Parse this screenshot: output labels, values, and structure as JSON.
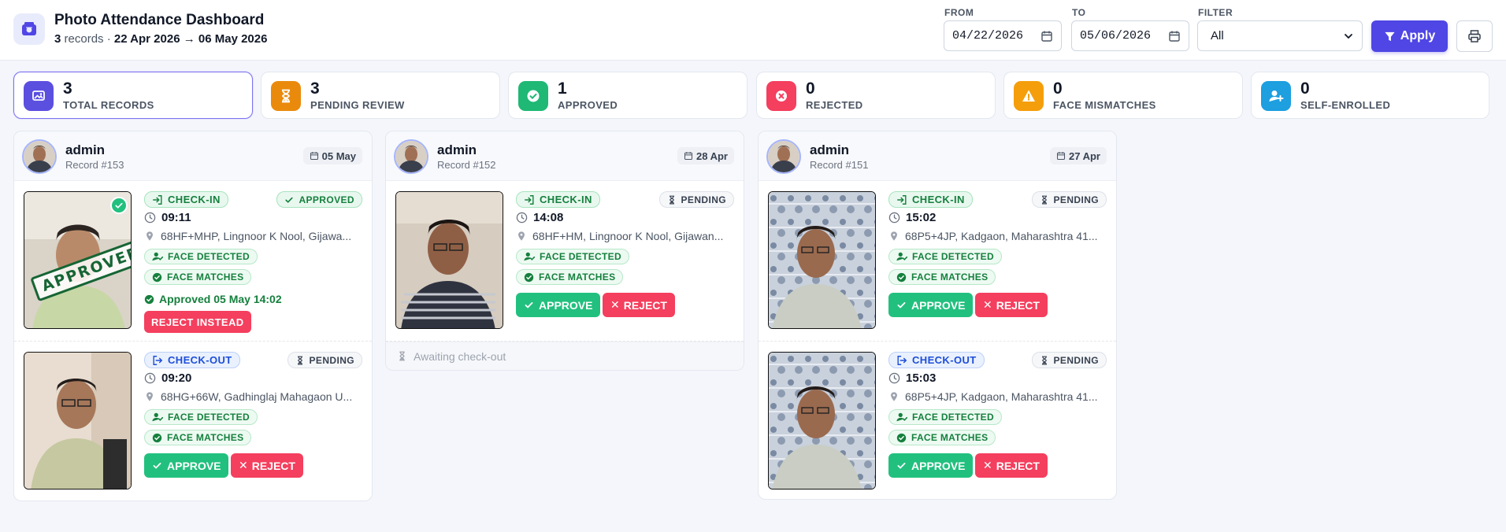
{
  "header": {
    "title": "Photo Attendance Dashboard",
    "record_count": "3",
    "records_word": "records",
    "separator": "·",
    "range_text": "22 Apr 2026 → 06 May 2026",
    "from_label": "FROM",
    "from_value": "04/22/2026",
    "to_label": "TO",
    "to_value": "05/06/2026",
    "filter_label": "FILTER",
    "filter_value": "All",
    "apply_label": "Apply"
  },
  "stats": [
    {
      "value": "3",
      "label": "TOTAL RECORDS",
      "icon": "photos-icon",
      "color": "#5b4fe0"
    },
    {
      "value": "3",
      "label": "PENDING REVIEW",
      "icon": "hourglass-icon",
      "color": "#ea8a0c"
    },
    {
      "value": "1",
      "label": "APPROVED",
      "icon": "check-circle-icon",
      "color": "#1fb875"
    },
    {
      "value": "0",
      "label": "REJECTED",
      "icon": "x-circle-icon",
      "color": "#f43f5e"
    },
    {
      "value": "0",
      "label": "FACE MISMATCHES",
      "icon": "warning-icon",
      "color": "#f59e0b"
    },
    {
      "value": "0",
      "label": "SELF-ENROLLED",
      "icon": "user-plus-icon",
      "color": "#1d9fe0"
    }
  ],
  "cards": [
    {
      "user": "admin",
      "record": "Record #153",
      "date": "05 May",
      "entries": [
        {
          "type": "CHECK-IN",
          "status": "APPROVED",
          "time": "09:11",
          "location": "68HF+MHP, Lingnoor K Nool, Gijawa...",
          "chip1": "FACE DETECTED",
          "chip2": "FACE MATCHES",
          "approved_note": "Approved 05 May 14:02",
          "reject_instead": "REJECT INSTEAD",
          "stamp": "APPROVED"
        },
        {
          "type": "CHECK-OUT",
          "status": "PENDING",
          "time": "09:20",
          "location": "68HG+66W, Gadhinglaj Mahagaon U...",
          "chip1": "FACE DETECTED",
          "chip2": "FACE MATCHES",
          "approve": "APPROVE",
          "reject": "REJECT"
        }
      ]
    },
    {
      "user": "admin",
      "record": "Record #152",
      "date": "28 Apr",
      "entries": [
        {
          "type": "CHECK-IN",
          "status": "PENDING",
          "time": "14:08",
          "location": "68HF+HM, Lingnoor K Nool, Gijawan...",
          "chip1": "FACE DETECTED",
          "chip2": "FACE MATCHES",
          "approve": "APPROVE",
          "reject": "REJECT"
        }
      ],
      "awaiting": "Awaiting check-out"
    },
    {
      "user": "admin",
      "record": "Record #151",
      "date": "27 Apr",
      "entries": [
        {
          "type": "CHECK-IN",
          "status": "PENDING",
          "time": "15:02",
          "location": "68P5+4JP, Kadgaon, Maharashtra 41...",
          "chip1": "FACE DETECTED",
          "chip2": "FACE MATCHES",
          "approve": "APPROVE",
          "reject": "REJECT"
        },
        {
          "type": "CHECK-OUT",
          "status": "PENDING",
          "time": "15:03",
          "location": "68P5+4JP, Kadgaon, Maharashtra 41...",
          "chip1": "FACE DETECTED",
          "chip2": "FACE MATCHES",
          "approve": "APPROVE",
          "reject": "REJECT"
        }
      ]
    }
  ]
}
